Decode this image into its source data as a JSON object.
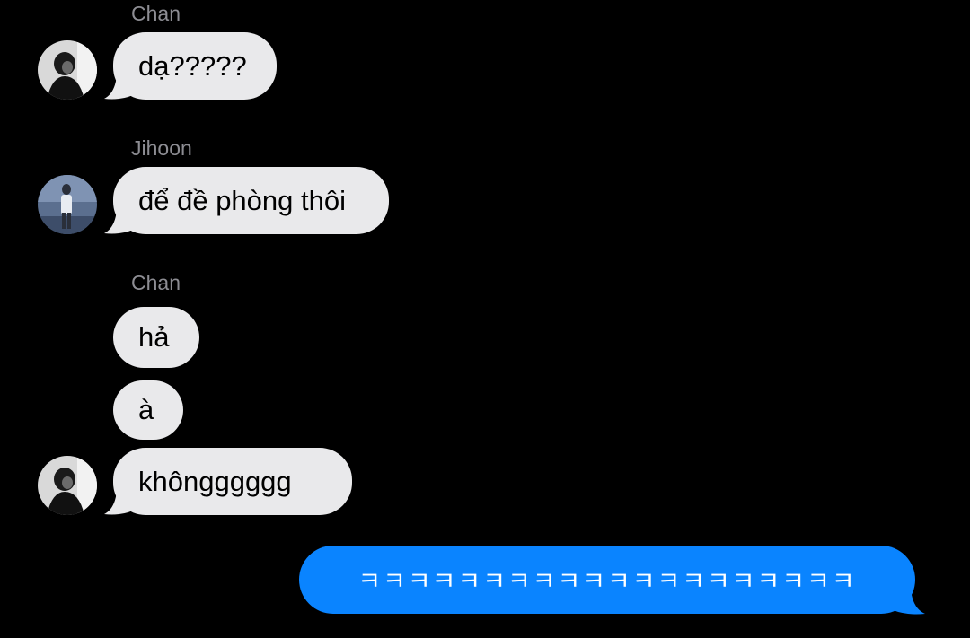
{
  "thread": {
    "groups": [
      {
        "sender": "Chan",
        "messages": [
          "dạ?????"
        ]
      },
      {
        "sender": "Jihoon",
        "messages": [
          "để đề phòng thôi"
        ]
      },
      {
        "sender": "Chan",
        "messages": [
          "hả",
          "à",
          "khôngggggg"
        ]
      }
    ],
    "outgoing": {
      "text": "ㅋㅋㅋㅋㅋㅋㅋㅋㅋㅋㅋㅋㅋㅋㅋㅋㅋㅋㅋㅋ"
    }
  },
  "colors": {
    "background": "#000000",
    "incoming_bubble": "#e9e9eb",
    "outgoing_bubble": "#0a84ff",
    "sender_label": "#8d8d93"
  },
  "icons": {
    "chan_avatar": "chan-avatar-photo",
    "jihoon_avatar": "jihoon-avatar-photo"
  }
}
